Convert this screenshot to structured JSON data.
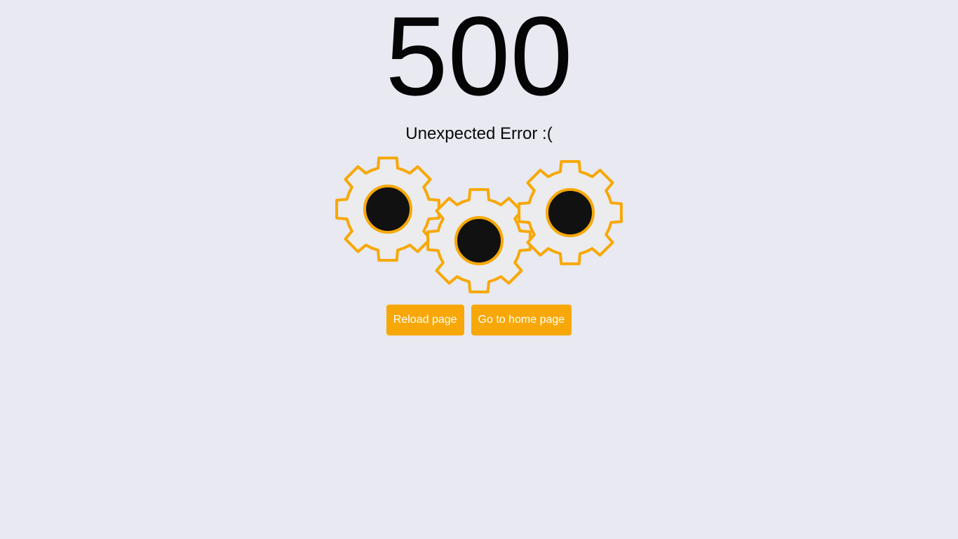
{
  "error": {
    "code": "500",
    "message": "Unexpected Error :("
  },
  "gears": [
    {
      "name": "gear-left"
    },
    {
      "name": "gear-center"
    },
    {
      "name": "gear-right"
    }
  ],
  "actions": {
    "reload_label": "Reload page",
    "home_label": "Go to home page"
  },
  "colors": {
    "background": "#e8e9f1",
    "accent": "#f7a808",
    "gear_fill": "#ececee",
    "gear_hub": "#111111",
    "text": "#050505"
  }
}
